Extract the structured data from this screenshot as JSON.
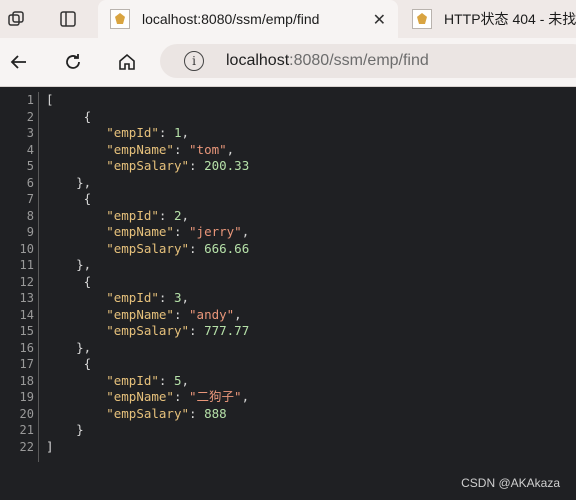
{
  "tabs": [
    {
      "title": "localhost:8080/ssm/emp/find",
      "active": true
    },
    {
      "title": "HTTP状态 404 - 未找",
      "active": false
    }
  ],
  "address": {
    "host": "localhost",
    "path": ":8080/ssm/emp/find"
  },
  "line_numbers": [
    "1",
    "2",
    "3",
    "4",
    "5",
    "6",
    "7",
    "8",
    "9",
    "10",
    "11",
    "12",
    "13",
    "14",
    "15",
    "16",
    "17",
    "18",
    "19",
    "20",
    "21",
    "22"
  ],
  "employees": [
    {
      "empId": "1",
      "empName": "tom",
      "empSalary": "200.33"
    },
    {
      "empId": "2",
      "empName": "jerry",
      "empSalary": "666.66"
    },
    {
      "empId": "3",
      "empName": "andy",
      "empSalary": "777.77"
    },
    {
      "empId": "5",
      "empName": "二狗子",
      "empSalary": "888"
    }
  ],
  "json_keys": {
    "id": "empId",
    "name": "empName",
    "salary": "empSalary"
  },
  "watermark": "CSDN @AKAkaza"
}
